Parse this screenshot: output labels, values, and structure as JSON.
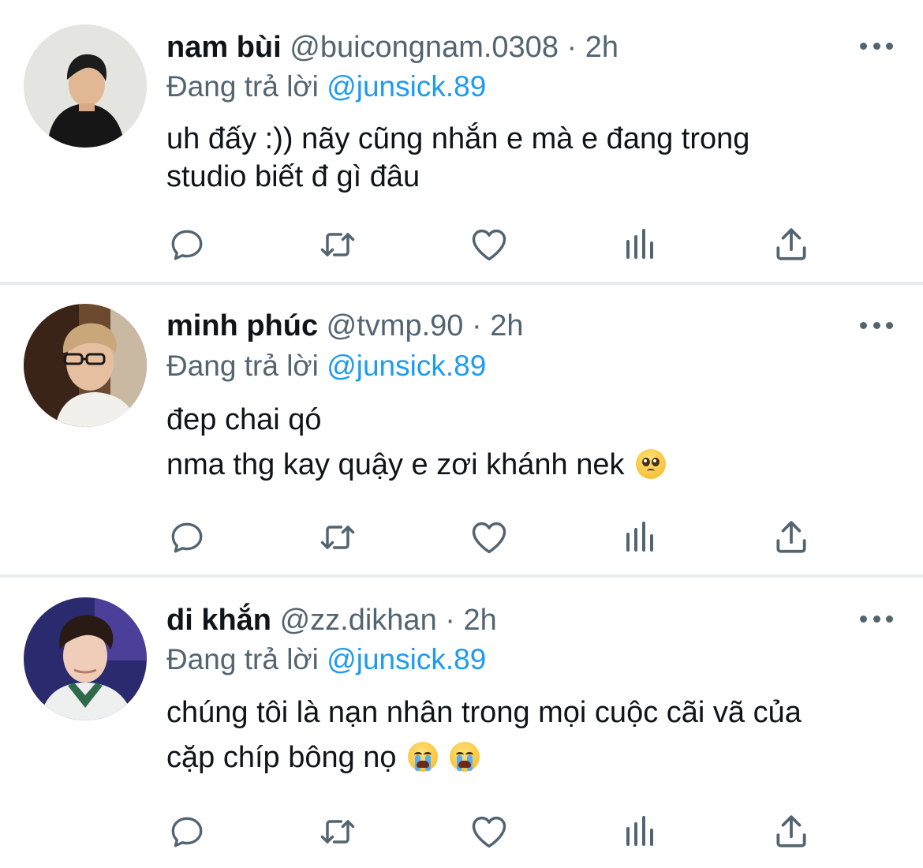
{
  "tweets": [
    {
      "name": "nam bùi",
      "handle": "@buicongnam.0308",
      "separator": "·",
      "time": "2h",
      "reply_prefix": "Đang trả lời",
      "reply_to": "@junsick.89",
      "lines": [
        "uh đấy :)) nãy cũng nhắn e mà e đang trong",
        "studio biết đ gì đâu"
      ]
    },
    {
      "name": "minh phúc",
      "handle": "@tvmp.90",
      "separator": "·",
      "time": "2h",
      "reply_prefix": "Đang trả lời",
      "reply_to": "@junsick.89",
      "lines": [
        "đep chai qó",
        "nma thg kay quậy e zơi khánh nek"
      ],
      "emoji": "pleading-face-emoji"
    },
    {
      "name": "di khắn",
      "handle": "@zz.dikhan",
      "separator": "·",
      "time": "2h",
      "reply_prefix": "Đang trả lời",
      "reply_to": "@junsick.89",
      "lines": [
        "chúng tôi là nạn nhân trong mọi cuộc cãi vã của",
        "cặp chíp bông nọ"
      ],
      "emoji": "loudly-crying-face-emoji"
    }
  ],
  "actions": [
    "reply-icon",
    "retweet-icon",
    "like-icon",
    "views-icon",
    "share-icon"
  ],
  "colors": {
    "text": "#0f1419",
    "secondary": "#536471",
    "mention": "#1d9bf0",
    "divider": "#e9ecef"
  }
}
